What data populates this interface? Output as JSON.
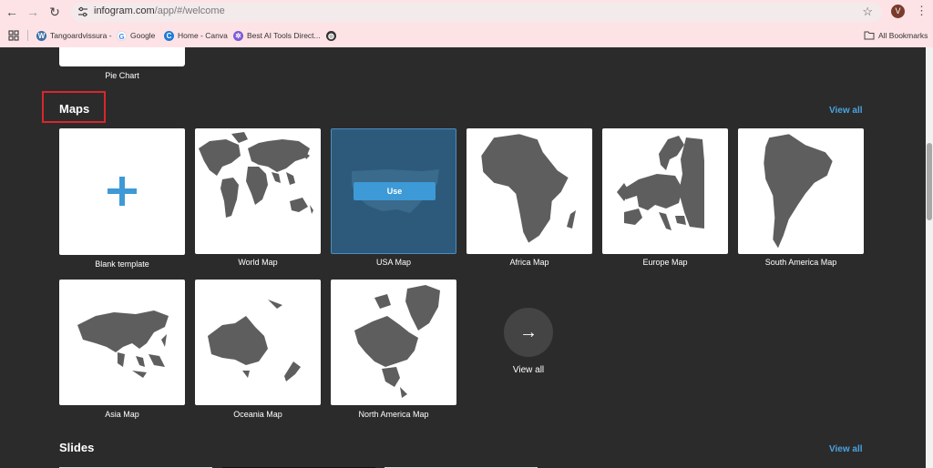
{
  "browser": {
    "url_host": "infogram.com",
    "url_path": "/app/#/welcome",
    "avatar_letter": "V",
    "bookmarks": [
      {
        "label": "Tangoardvissura -",
        "icon": "wordpress-icon",
        "color": "#3a6ea5"
      },
      {
        "label": "Google",
        "icon": "google-icon",
        "color": "#4285f4"
      },
      {
        "label": "Home - Canva",
        "icon": "canva-icon",
        "color": "#1f7bd6"
      },
      {
        "label": "Best AI Tools Direct...",
        "icon": "gear-icon",
        "color": "#7b5bd6"
      },
      {
        "label": "",
        "icon": "globe-icon",
        "color": "#333333"
      }
    ],
    "all_bookmarks_label": "All Bookmarks"
  },
  "page": {
    "prev_section_caption": "Pie Chart",
    "maps_title": "Maps",
    "view_all_label": "View all",
    "maps": [
      {
        "caption": "Blank template",
        "kind": "blank"
      },
      {
        "caption": "World Map",
        "kind": "world"
      },
      {
        "caption": "USA Map",
        "kind": "usa",
        "hover_button": "Use"
      },
      {
        "caption": "Africa Map",
        "kind": "africa"
      },
      {
        "caption": "Europe Map",
        "kind": "europe"
      },
      {
        "caption": "South America Map",
        "kind": "southamerica"
      },
      {
        "caption": "Asia Map",
        "kind": "asia"
      },
      {
        "caption": "Oceania Map",
        "kind": "oceania"
      },
      {
        "caption": "North America Map",
        "kind": "northamerica"
      }
    ],
    "view_all_tile_label": "View all",
    "slides_title": "Slides",
    "slides_view_all_label": "View all"
  },
  "colors": {
    "accent": "#4aa3df",
    "map_fill": "#5e5e5e",
    "background": "#2b2b2b",
    "highlight": "#d9262e"
  }
}
